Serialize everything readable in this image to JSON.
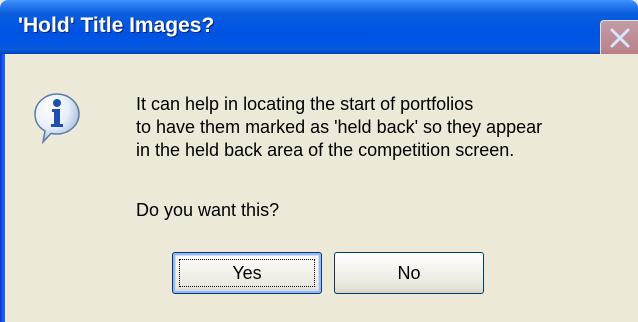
{
  "dialog": {
    "title": "'Hold' Title Images?",
    "icon": "information-icon",
    "message_lines": [
      "It can help in locating the start of portfolios",
      "to have them marked as 'held back' so they appear",
      "in the held back area of the competition screen."
    ],
    "question": "Do you want this?",
    "buttons": {
      "yes_label": "Yes",
      "no_label": "No"
    }
  },
  "colors": {
    "titlebar": "#0054e3",
    "dialog_background": "#ece9d8",
    "button_border": "#003c74",
    "close_button": "#e6a89a"
  }
}
